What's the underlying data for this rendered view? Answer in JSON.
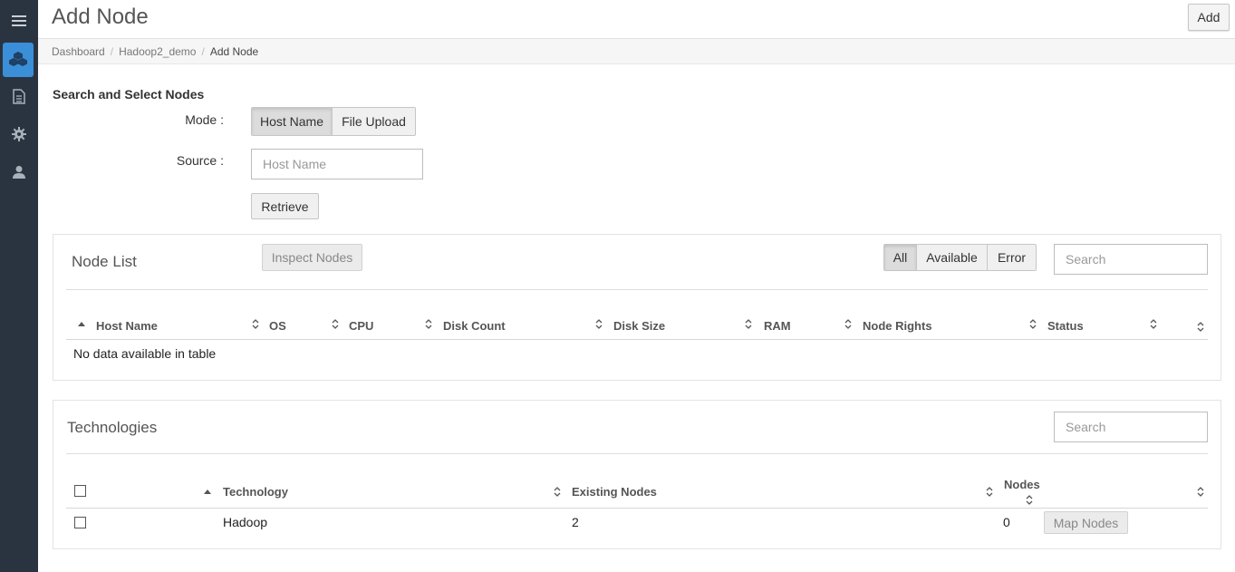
{
  "sidebar": {
    "items": [
      {
        "icon": "menu-icon"
      },
      {
        "icon": "cluster-icon",
        "active": true
      },
      {
        "icon": "document-icon"
      },
      {
        "icon": "gear-icon"
      },
      {
        "icon": "user-icon"
      }
    ],
    "accent": "#3a8fd8",
    "background": "#2a3440"
  },
  "header": {
    "title": "Add Node",
    "add_label": "Add"
  },
  "breadcrumb": {
    "items": [
      "Dashboard",
      "Hadoop2_demo"
    ],
    "current": "Add Node"
  },
  "search_select": {
    "title": "Search and Select Nodes",
    "mode_label": "Mode :",
    "mode_options": [
      "Host Name",
      "File Upload"
    ],
    "mode_selected": "Host Name",
    "source_label": "Source :",
    "source_placeholder": "Host Name",
    "retrieve_label": "Retrieve"
  },
  "node_list": {
    "title": "Node List",
    "inspect_label": "Inspect Nodes",
    "filters": [
      "All",
      "Available",
      "Error"
    ],
    "filter_selected": "All",
    "search_placeholder": "Search",
    "columns": [
      "Host Name",
      "OS",
      "CPU",
      "Disk Count",
      "Disk Size",
      "RAM",
      "Node Rights",
      "Status"
    ],
    "empty_message": "No data available in table"
  },
  "technologies": {
    "title": "Technologies",
    "search_placeholder": "Search",
    "columns": [
      "Technology",
      "Existing Nodes",
      "Nodes"
    ],
    "rows": [
      {
        "technology": "Hadoop",
        "existing_nodes": "2",
        "nodes": "0",
        "action": "Map Nodes"
      }
    ]
  }
}
